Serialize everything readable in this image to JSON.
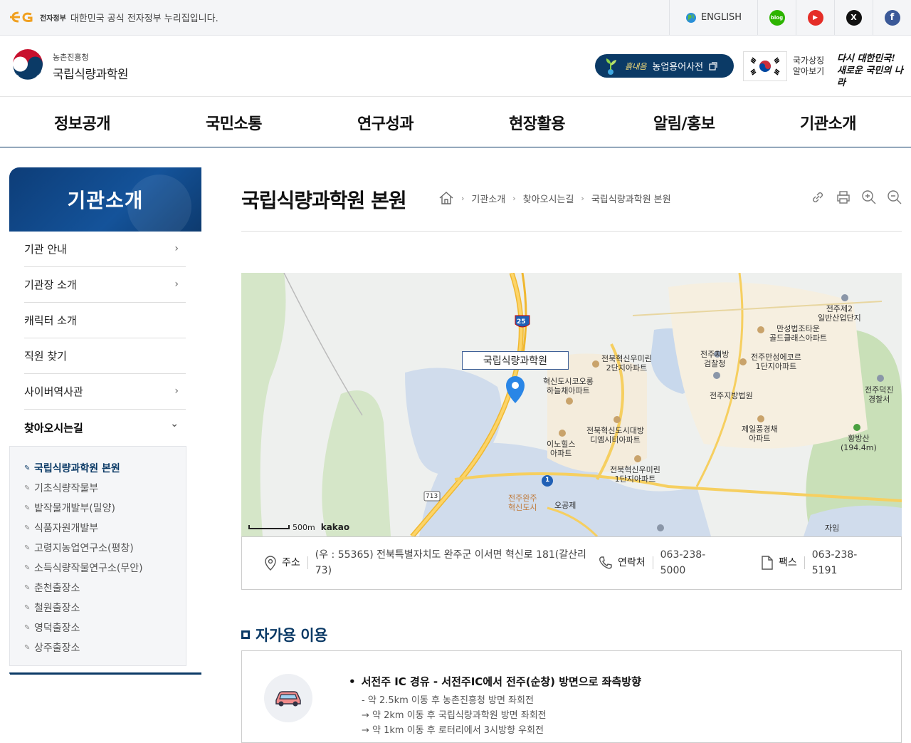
{
  "gov_banner": {
    "badge": "전자정부",
    "text": "대한민국 공식 전자정부 누리집입니다.",
    "english": "ENGLISH",
    "sns": [
      {
        "name": "blog",
        "glyph": "blog",
        "color": "#2db400"
      },
      {
        "name": "youtube",
        "glyph": "▶",
        "color": "#e52d27"
      },
      {
        "name": "x",
        "glyph": "X",
        "color": "#111111"
      },
      {
        "name": "facebook",
        "glyph": "f",
        "color": "#3b5998"
      }
    ]
  },
  "header": {
    "logo_sub": "농촌진흥청",
    "logo_main": "국립식량과학원",
    "dict_button": "농업용어사전",
    "dict_leaf": "흙내음",
    "nation_label_1": "국가상징",
    "nation_label_2": "알아보기",
    "slogan_1": "다시 대한민국!",
    "slogan_2": "새로운 국민의 나라"
  },
  "gnb": [
    "정보공개",
    "국민소통",
    "연구성과",
    "현장활용",
    "알림/홍보",
    "기관소개"
  ],
  "sidebar": {
    "title": "기관소개",
    "items": [
      {
        "label": "기관 안내",
        "arrow": "›"
      },
      {
        "label": "기관장 소개",
        "arrow": "›"
      },
      {
        "label": "캐릭터 소개",
        "arrow": ""
      },
      {
        "label": "직원 찾기",
        "arrow": ""
      },
      {
        "label": "사이버역사관",
        "arrow": "›"
      },
      {
        "label": "찾아오시는길",
        "arrow": "⌄"
      }
    ],
    "sub_items": [
      "국립식량과학원 본원",
      "기초식량작물부",
      "밭작물개발부(밀양)",
      "식품자원개발부",
      "고령지농업연구소(평창)",
      "소득식량작물연구소(무안)",
      "춘천출장소",
      "철원출장소",
      "영덕출장소",
      "상주출장소"
    ]
  },
  "content": {
    "title": "국립식량과학원 본원",
    "breadcrumb": [
      "기관소개",
      "찾아오시는길",
      "국립식량과학원 본원"
    ]
  },
  "map": {
    "marker_label": "국립식량과학원",
    "scale": "500m",
    "brand": "kakao",
    "labels": [
      "전주제2\n일반산업단지",
      "만성법조타운\n골드클래스아파트",
      "전북혁신우미린\n2단지아파트",
      "전주지방\n검찰청",
      "전주만성에코르\n1단지아파트",
      "혁신도시코오롱\n하늘채아파트",
      "전주지방법원",
      "전주덕진\n경찰서",
      "전북혁신도시대방\n디엠시티아파트",
      "제일풍경채\n아파트",
      "이노힐스\n아파트",
      "황방산\n(194.4m)",
      "전북혁신우미린\n1단지아파트",
      "전주완주\n혁신도시",
      "오공제",
      "자임"
    ],
    "road_badges": [
      "25",
      "1",
      "713"
    ]
  },
  "info": {
    "address_label": "주소",
    "address_line1": "(우 : 55365) 전북특별자치도 완주군 이서면 혁신로 181(갈산리",
    "address_line2": "73)",
    "phone_label": "연락처",
    "phone_line1": "063-238-",
    "phone_line2": "5000",
    "fax_label": "팩스",
    "fax_line1": "063-238-",
    "fax_line2": "5191"
  },
  "section": {
    "title": "자가용 이용",
    "route_head": "서전주 IC 경유 - 서전주IC에서 전주(순창) 방면으로 좌측방향",
    "route_lines": [
      "- 약 2.5km 이동 후 농촌진흥청 방면 좌회전",
      "→ 약 2km 이동 후 국립식량과학원 방면 좌회전",
      "→ 약 1km 이동 후 로터리에서 3시방향 우회전"
    ]
  }
}
